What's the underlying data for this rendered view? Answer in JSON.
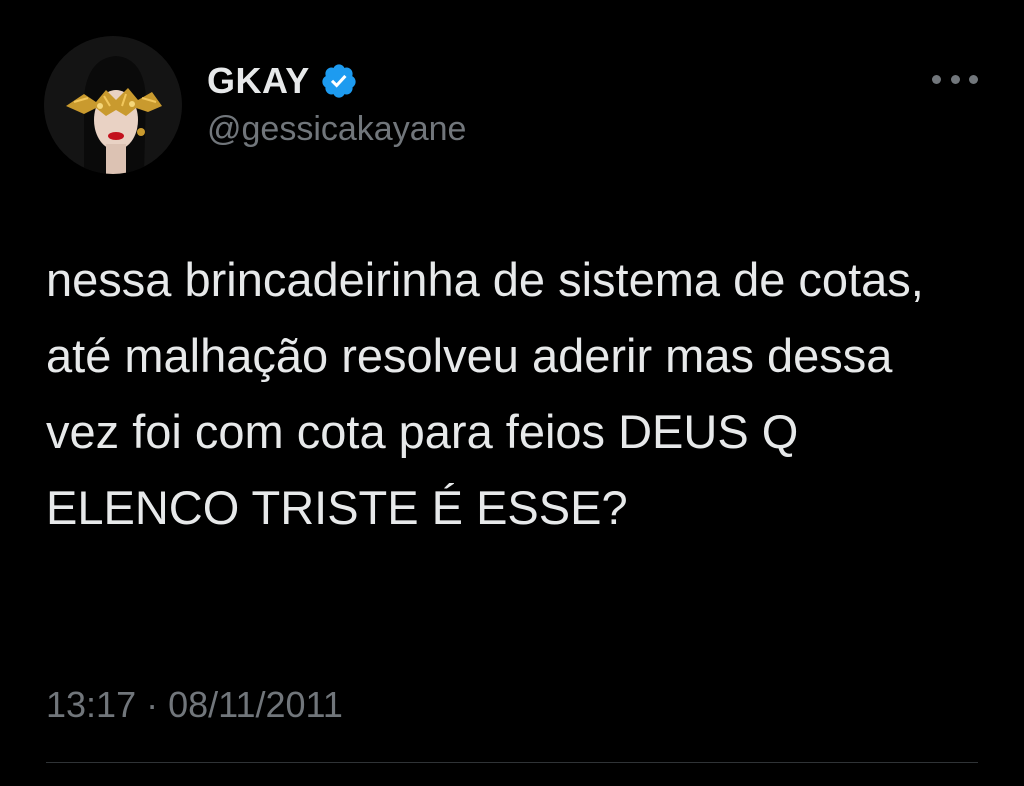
{
  "tweet": {
    "author": {
      "display_name": "GKAY",
      "handle": "@gessicakayane",
      "verified": true,
      "avatar_icon": "masked-woman-avatar"
    },
    "text": "nessa brincadeirinha de sistema de cotas, até malhação resolveu aderir mas dessa vez foi com cota para feios DEUS Q ELENCO TRISTE É ESSE?",
    "timestamp": "13:17 · 08/11/2011",
    "menu_icon": "more-options-icon"
  },
  "colors": {
    "background": "#000000",
    "primary_text": "#e7e9ea",
    "secondary_text": "#71767b",
    "verified_blue": "#1d9bf0",
    "divider": "#2f3336"
  }
}
